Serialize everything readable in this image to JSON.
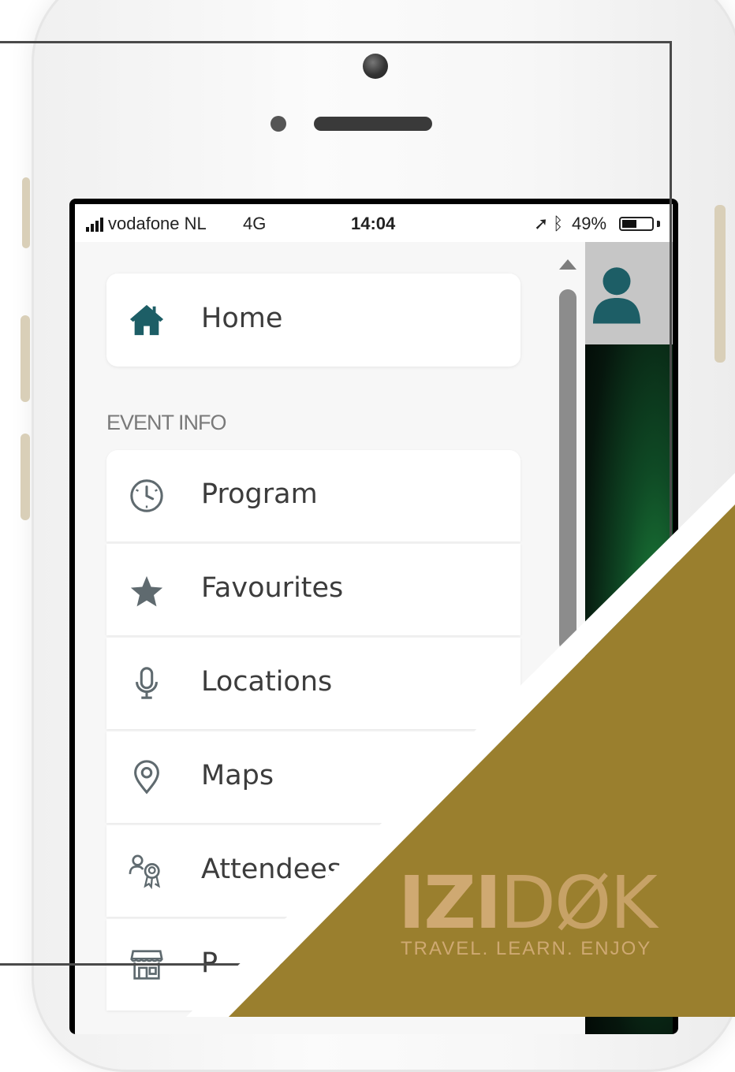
{
  "status_bar": {
    "carrier": "vodafone NL",
    "network": "4G",
    "time": "14:04",
    "battery_percent": "49%",
    "battery_level": 0.49
  },
  "menu": {
    "home_label": "Home",
    "section_label": "EVENT INFO",
    "items": [
      {
        "label": "Program",
        "icon": "clock-icon"
      },
      {
        "label": "Favourites",
        "icon": "star-icon"
      },
      {
        "label": "Locations",
        "icon": "microphone-icon"
      },
      {
        "label": "Maps",
        "icon": "map-pin-icon"
      },
      {
        "label": "Attendees",
        "icon": "attendees-icon"
      },
      {
        "label": "P",
        "icon": "storefront-icon"
      }
    ]
  },
  "overlay": {
    "brand": "IZIDØK",
    "brand_bold": "IZI",
    "brand_light": "DØK",
    "tagline": "TRAVEL. LEARN. ENJOY"
  },
  "colors": {
    "accent": "#1d5e66",
    "icon_gray": "#5f6a6f",
    "gold": "#9a7f2e",
    "brand_text": "#cfa972"
  }
}
